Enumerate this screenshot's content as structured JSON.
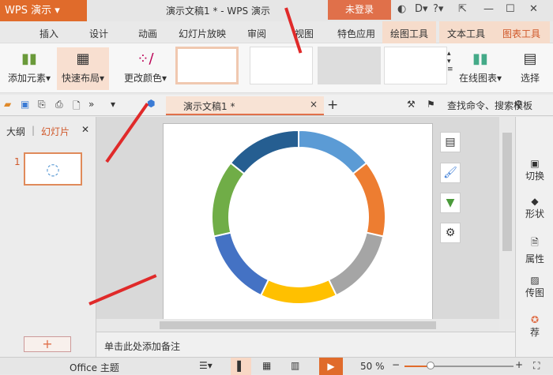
{
  "app": {
    "logo": "WPS 演示",
    "title": "演示文稿1 * - WPS 演示",
    "login": "未登录"
  },
  "tabs": [
    "插入",
    "设计",
    "动画",
    "幻灯片放映",
    "审阅",
    "视图",
    "特色应用",
    "绘图工具",
    "文本工具",
    "图表工具"
  ],
  "toolbar": {
    "add_element": "添加元素",
    "quick_layout": "快速布局",
    "change_color": "更改颜色",
    "online_chart": "在线图表",
    "select": "选择"
  },
  "doc_tab": "演示文稿1 *",
  "search": "查找命令、搜索模板",
  "left_panel": {
    "outline": "大纲",
    "slides": "幻灯片",
    "slide_number": "1"
  },
  "right_panel": [
    "切换",
    "形状",
    "属性",
    "传图",
    "荐"
  ],
  "notes_placeholder": "单击此处添加备注",
  "status": {
    "theme": "Office 主题",
    "zoom": "50 %"
  },
  "colors": {
    "accent": "#e06b2b"
  },
  "donut_colors": [
    "#5b9bd5",
    "#ed7d31",
    "#a5a5a5",
    "#ffc000",
    "#4472c4",
    "#70ad47",
    "#255e91"
  ]
}
